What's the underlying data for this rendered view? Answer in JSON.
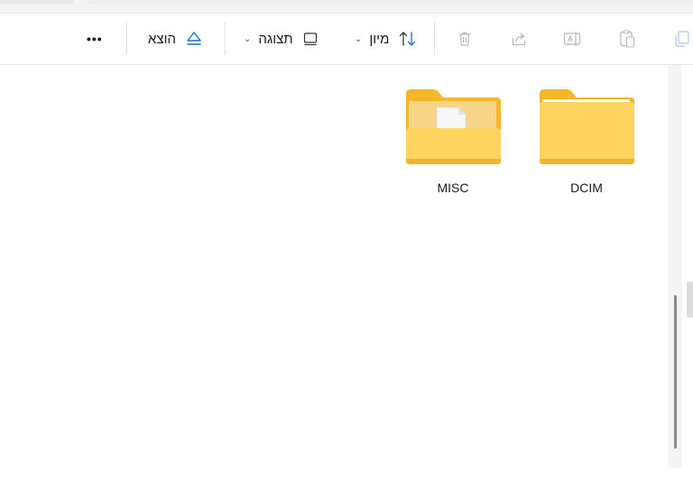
{
  "toolbar": {
    "eject_label": "הוצא",
    "view_label": "תצוגה",
    "sort_label": "מיון",
    "more_label": "•••"
  },
  "folders": [
    {
      "name": "DCIM",
      "icon": "folder-icon"
    },
    {
      "name": "MISC",
      "icon": "folder-with-document-icon"
    }
  ],
  "colors": {
    "folder_yellow": "#FFD45E",
    "folder_back": "#F5B72A",
    "accent_blue": "#1A6FC4"
  }
}
